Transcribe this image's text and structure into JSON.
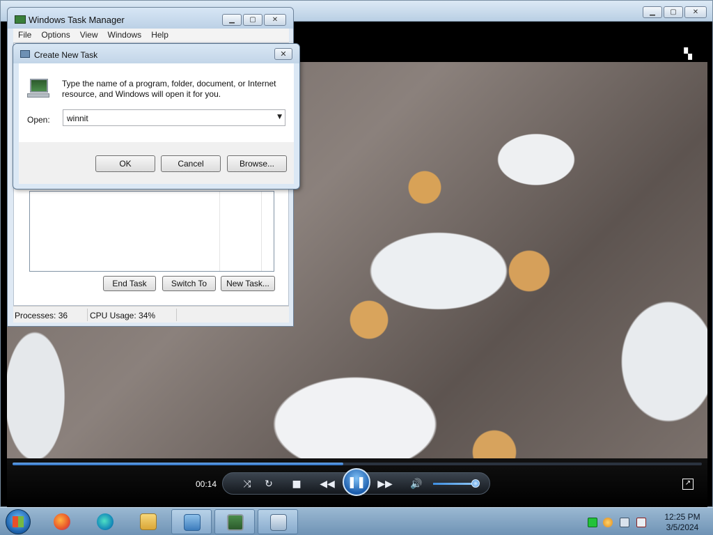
{
  "task_manager": {
    "title": "Windows Task Manager",
    "menu": [
      "File",
      "Options",
      "View",
      "Windows",
      "Help"
    ],
    "buttons": {
      "end_task": "End Task",
      "switch_to": "Switch To",
      "new_task": "New Task..."
    },
    "status": {
      "processes": "Processes: 36",
      "cpu": "CPU Usage: 34%"
    }
  },
  "create_task_dialog": {
    "title": "Create New Task",
    "message": "Type the name of a program, folder, document, or Internet resource, and Windows will open it for you.",
    "open_label": "Open:",
    "open_value": "winnit",
    "buttons": {
      "ok": "OK",
      "cancel": "Cancel",
      "browse": "Browse..."
    }
  },
  "media_player": {
    "time": "00:14",
    "progress_fraction": 0.48,
    "volume_fraction": 0.8
  },
  "taskbar": {
    "clock_time": "12:25 PM",
    "clock_date": "3/5/2024",
    "apps": [
      "firefox-icon",
      "edge-icon",
      "file-explorer-icon",
      "media-player-icon",
      "task-manager-icon",
      "remote-desktop-icon"
    ]
  },
  "colors": {
    "accent": "#2d6fc4",
    "taskbar": "#7f9fbf"
  }
}
